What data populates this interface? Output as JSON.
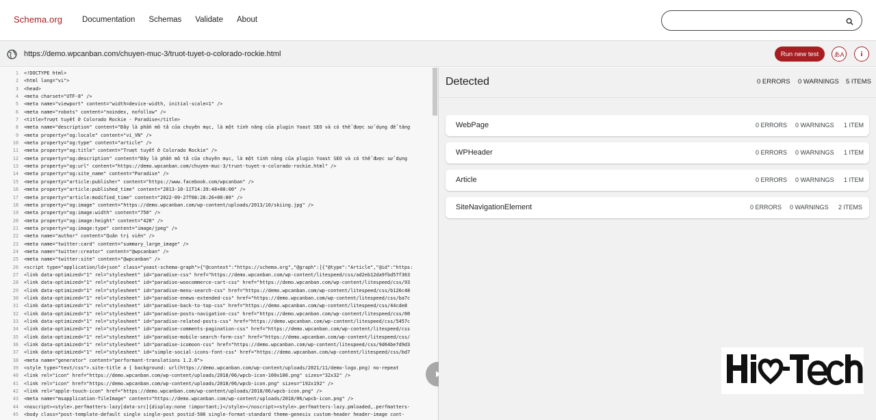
{
  "header": {
    "brand": "Schema.org",
    "nav": [
      "Documentation",
      "Schemas",
      "Validate",
      "About"
    ],
    "search_value": ""
  },
  "urlbar": {
    "url": "https://demo.wpcanban.com/chuyen-muc-3/truot-tuyet-o-colorado-rockie.html",
    "run_label": "Run new test",
    "lang_btn": "あA",
    "info_btn": "i"
  },
  "code": {
    "line_numbers": [
      "1",
      "2",
      "3",
      "4",
      "5",
      "6",
      "7",
      "8",
      "9",
      "10",
      "11",
      "12",
      "13",
      "14",
      "15",
      "16",
      "17",
      "18",
      "19",
      "20",
      "21",
      "22",
      "23",
      "24",
      "25",
      "26",
      "27",
      "28",
      "29",
      "30",
      "31",
      "32",
      "33",
      "34",
      "35",
      "36",
      "37",
      "38",
      "39",
      "40",
      "41",
      "42",
      "43",
      "44",
      "45"
    ],
    "lines": [
      "<!DOCTYPE html>",
      "<html lang=\"vi\">",
      "<head>",
      "<meta charset=\"UTF-8\" />",
      "<meta name=\"viewport\" content=\"width=device-width, initial-scale=1\" />",
      "<meta name=\"robots\" content=\"noindex, nofollow\" />",
      "<title>Trượt tuyết ở Colorado Rockie - Paradise</title>",
      "<meta name=\"description\" content=\"Đây là phần mô tả của chuyên mục, là một tính năng của plugin Yoast SEO và có thể được sử dụng để tăng",
      "<meta property=\"og:locale\" content=\"vi_VN\" />",
      "<meta property=\"og:type\" content=\"article\" />",
      "<meta property=\"og:title\" content=\"Trượt tuyết ở Colorado Rockie\" />",
      "<meta property=\"og:description\" content=\"Đây là phần mô tả của chuyên mục, là một tính năng của plugin Yoast SEO và có thể được sử dụng",
      "<meta property=\"og:url\" content=\"https://demo.wpcanban.com/chuyen-muc-3/truot-tuyet-o-colorado-rockie.html\" />",
      "<meta property=\"og:site_name\" content=\"Paradise\" />",
      "<meta property=\"article:publisher\" content=\"https://www.facebook.com/wpcanban\" />",
      "<meta property=\"article:published_time\" content=\"2013-10-11T14:39:48+00:00\" />",
      "<meta property=\"article:modified_time\" content=\"2022-09-27T08:28:26+00:00\" />",
      "<meta property=\"og:image\" content=\"https://demo.wpcanban.com/wp-content/uploads/2013/10/skiing.jpg\" />",
      "<meta property=\"og:image:width\" content=\"750\" />",
      "<meta property=\"og:image:height\" content=\"420\" />",
      "<meta property=\"og:image:type\" content=\"image/jpeg\" />",
      "<meta name=\"author\" content=\"Quản trị viên\" />",
      "<meta name=\"twitter:card\" content=\"summary_large_image\" />",
      "<meta name=\"twitter:creator\" content=\"@wpcanban\" />",
      "<meta name=\"twitter:site\" content=\"@wpcanban\" />",
      "<script type=\"application/ld+json\" class=\"yoast-schema-graph\">{\"@context\":\"https://schema.org\",\"@graph\":[{\"@type\":\"Article\",\"@id\":\"https:",
      "<link data-optimized=\"1\" rel=\"stylesheet\" id=\"paradise-css\" href=\"https://demo.wpcanban.com/wp-content/litespeed/css/ad2eb12da9fbd57f363",
      "<link data-optimized=\"1\" rel=\"stylesheet\" id=\"paradise-woocommerce-cart-css\" href=\"https://demo.wpcanban.com/wp-content/litespeed/css/93",
      "<link data-optimized=\"1\" rel=\"stylesheet\" id=\"paradise-menu-search-css\" href=\"https://demo.wpcanban.com/wp-content/litespeed/css/b126c48",
      "<link data-optimized=\"1\" rel=\"stylesheet\" id=\"paradise-enews-extended-css\" href=\"https://demo.wpcanban.com/wp-content/litespeed/css/ba7c",
      "<link data-optimized=\"1\" rel=\"stylesheet\" id=\"paradise-back-to-top-css\" href=\"https://demo.wpcanban.com/wp-content/litespeed/css/44cde8",
      "<link data-optimized=\"1\" rel=\"stylesheet\" id=\"paradise-posts-navigation-css\" href=\"https://demo.wpcanban.com/wp-content/litespeed/css/00",
      "<link data-optimized=\"1\" rel=\"stylesheet\" id=\"paradise-related-posts-css\" href=\"https://demo.wpcanban.com/wp-content/litespeed/css/5457c",
      "<link data-optimized=\"1\" rel=\"stylesheet\" id=\"paradise-comments-pagination-css\" href=\"https://demo.wpcanban.com/wp-content/litespeed/css",
      "<link data-optimized=\"1\" rel=\"stylesheet\" id=\"paradise-mobile-search-form-css\" href=\"https://demo.wpcanban.com/wp-content/litespeed/css/",
      "<link data-optimized=\"1\" rel=\"stylesheet\" id=\"paradise-icomoon-css\" href=\"https://demo.wpcanban.com/wp-content/litespeed/css/9d64be7d9d3",
      "<link data-optimized=\"1\" rel=\"stylesheet\" id=\"simple-social-icons-font-css\" href=\"https://demo.wpcanban.com/wp-content/litespeed/css/bd7",
      "<meta name=\"generator\" content=\"performant-translations 1.2.0\">",
      "<style type=\"text/css\">.site-title a { background: url(https://demo.wpcanban.com/wp-content/uploads/2021/11/demo-logo.png) no-repeat",
      "<link rel=\"icon\" href=\"https://demo.wpcanban.com/wp-content/uploads/2018/06/wpcb-icon-100x100.png\" sizes=\"32x32\" />",
      "<link rel=\"icon\" href=\"https://demo.wpcanban.com/wp-content/uploads/2018/06/wpcb-icon.png\" sizes=\"192x192\" />",
      "<link rel=\"apple-touch-icon\" href=\"https://demo.wpcanban.com/wp-content/uploads/2018/06/wpcb-icon.png\" />",
      "<meta name=\"msapplication-TileImage\" content=\"https://demo.wpcanban.com/wp-content/uploads/2018/06/wpcb-icon.png\" />",
      "<noscript><style>.perfmatters-lazy[data-src]{display:none !important;}</style></noscript><style>.perfmatters-lazy.pmloaded,.perfmatters-",
      "<body class=\"post-template-default single single-post postid-586 single-format-standard theme-genesis custom-header header-image cont-"
    ]
  },
  "results": {
    "title": "Detected",
    "errors": "0 ERRORS",
    "warnings": "0 WARNINGS",
    "items": "5 ITEMS",
    "list": [
      {
        "name": "WebPage",
        "errors": "0 ERRORS",
        "warnings": "0 WARNINGS",
        "items": "1 ITEM"
      },
      {
        "name": "WPHeader",
        "errors": "0 ERRORS",
        "warnings": "0 WARNINGS",
        "items": "1 ITEM"
      },
      {
        "name": "Article",
        "errors": "0 ERRORS",
        "warnings": "0 WARNINGS",
        "items": "1 ITEM"
      },
      {
        "name": "SiteNavigationElement",
        "errors": "0 ERRORS",
        "warnings": "0 WARNINGS",
        "items": "2 ITEMS"
      }
    ]
  },
  "watermark": {
    "text": "Hi-Tech"
  },
  "colors": {
    "brand": "#a61e22",
    "code_bg": "#f7f7f7",
    "results_bg": "#f1f1f1"
  }
}
